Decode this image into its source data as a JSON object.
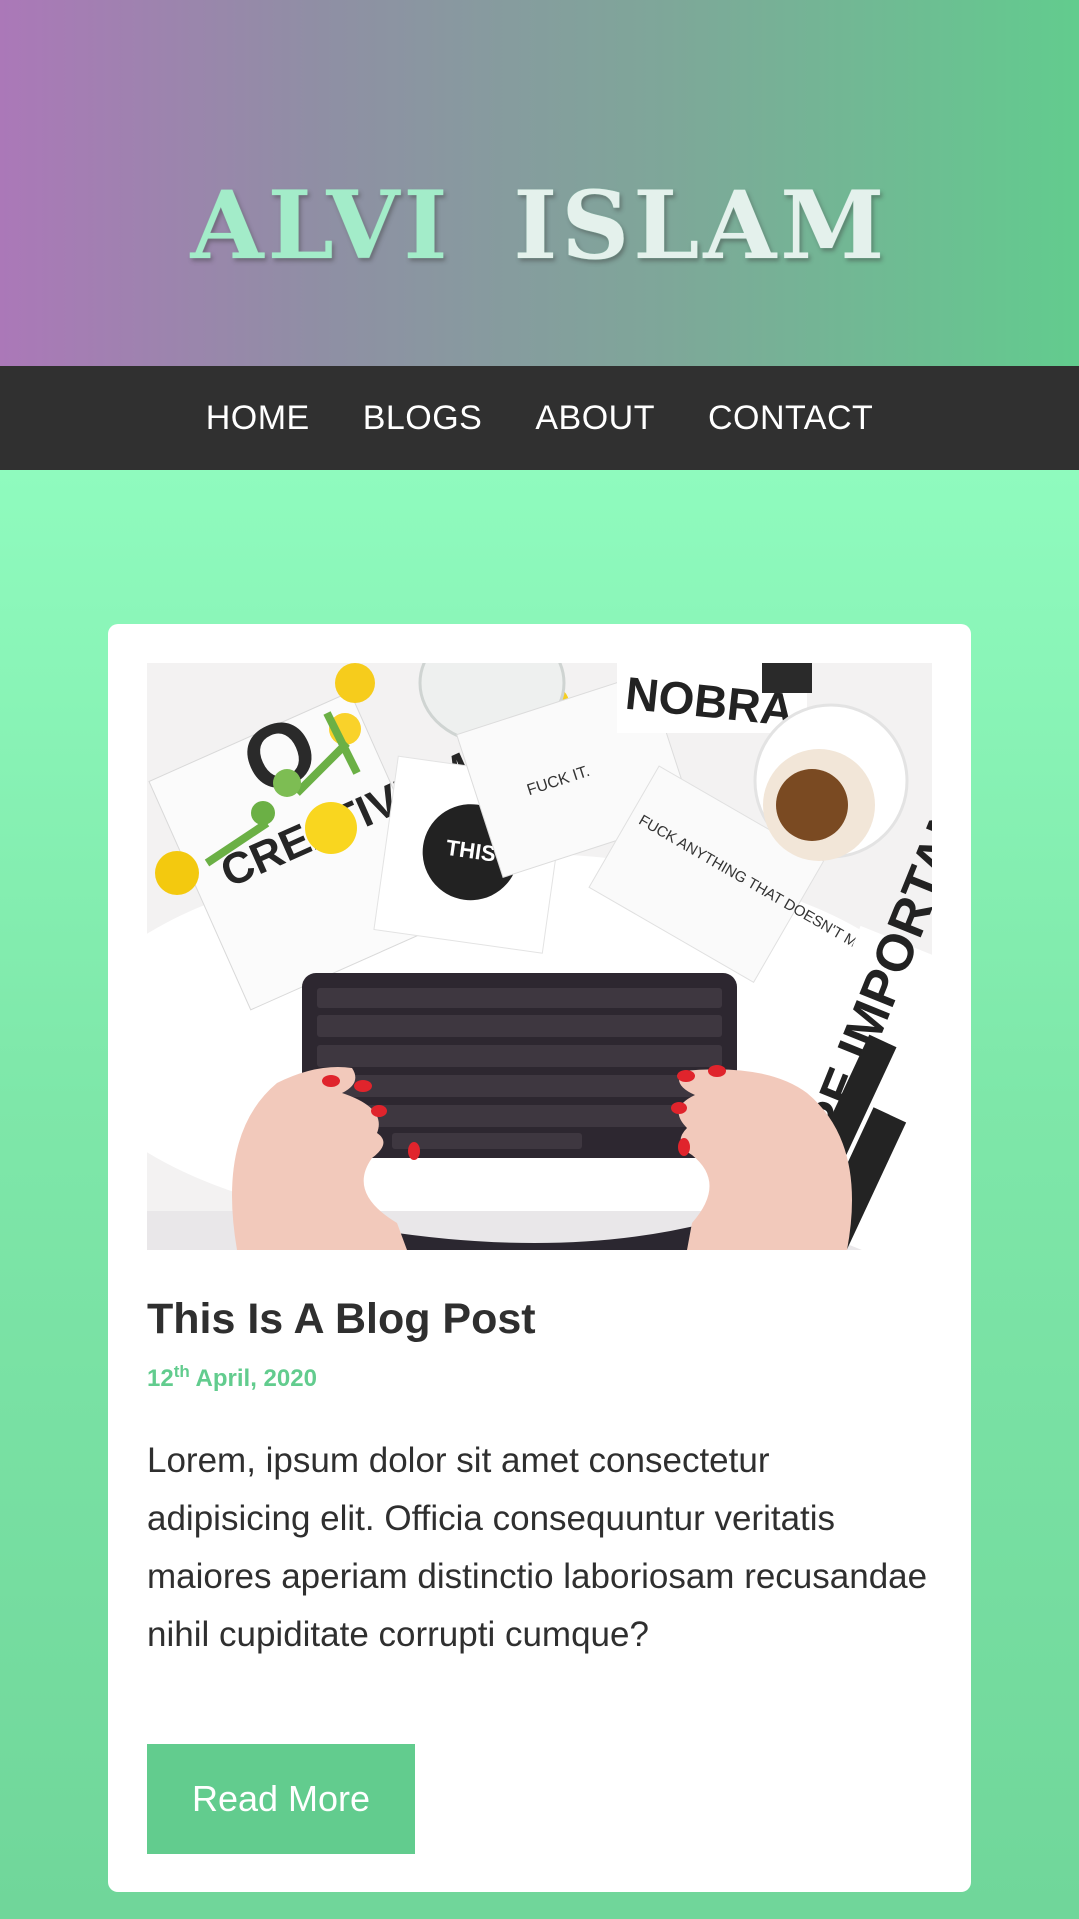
{
  "header": {
    "title_first": "ALVI",
    "title_second": "ISLAM"
  },
  "nav": {
    "items": [
      {
        "label": "HOME"
      },
      {
        "label": "BLOGS"
      },
      {
        "label": "ABOUT"
      },
      {
        "label": "CONTACT"
      }
    ]
  },
  "post": {
    "image": {
      "notebook_text": "CREATIVE MESS",
      "sticker_text": "THIS IS IT",
      "note_text": "FUCK ANYTHING THAT DOESN'T MAKE YOU HAPPY.",
      "poster_top": "NOBRA",
      "poster_side": "MORE IMPORTANT THAN",
      "paper_text": "FUCK IT."
    },
    "title": "This Is A Blog Post",
    "date_day": "12",
    "date_suffix": "th",
    "date_rest": " April, 2020",
    "excerpt": "Lorem, ipsum dolor sit amet consectetur adipisicing elit. Officia consequuntur veritatis maiores aperiam distinctio laboriosam recusandae nihil cupiditate corrupti cumque?",
    "read_more_label": "Read More"
  },
  "colors": {
    "accent": "#62cc8e",
    "nav_bg": "#303030",
    "header_gradient_start": "#ab78b8",
    "header_gradient_end": "#62cc8e",
    "page_bg": "#8ffbbe",
    "text_dark": "#2f2f2f"
  }
}
